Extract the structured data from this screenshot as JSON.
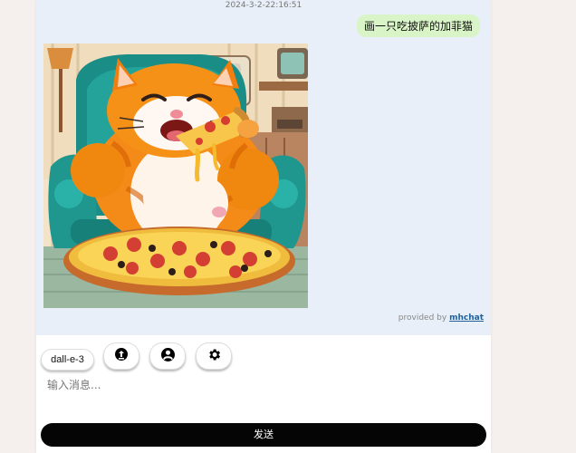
{
  "chat": {
    "timestamp": "2024-3-2-22:16:51",
    "user_message": "画一只吃披萨的加菲猫",
    "provided_by_prefix": "provided by",
    "provided_by_link": "mhchat"
  },
  "toolbar": {
    "model_label": "dall-e-3",
    "buttons": [
      "upload-icon",
      "user-icon",
      "gear-icon"
    ]
  },
  "composer": {
    "placeholder": "输入消息...",
    "send_label": "发送"
  },
  "colors": {
    "chat_background": "#e8eff8",
    "user_bubble": "#d9f4c7",
    "send_button": "#050505",
    "link": "#1f5f9e"
  }
}
